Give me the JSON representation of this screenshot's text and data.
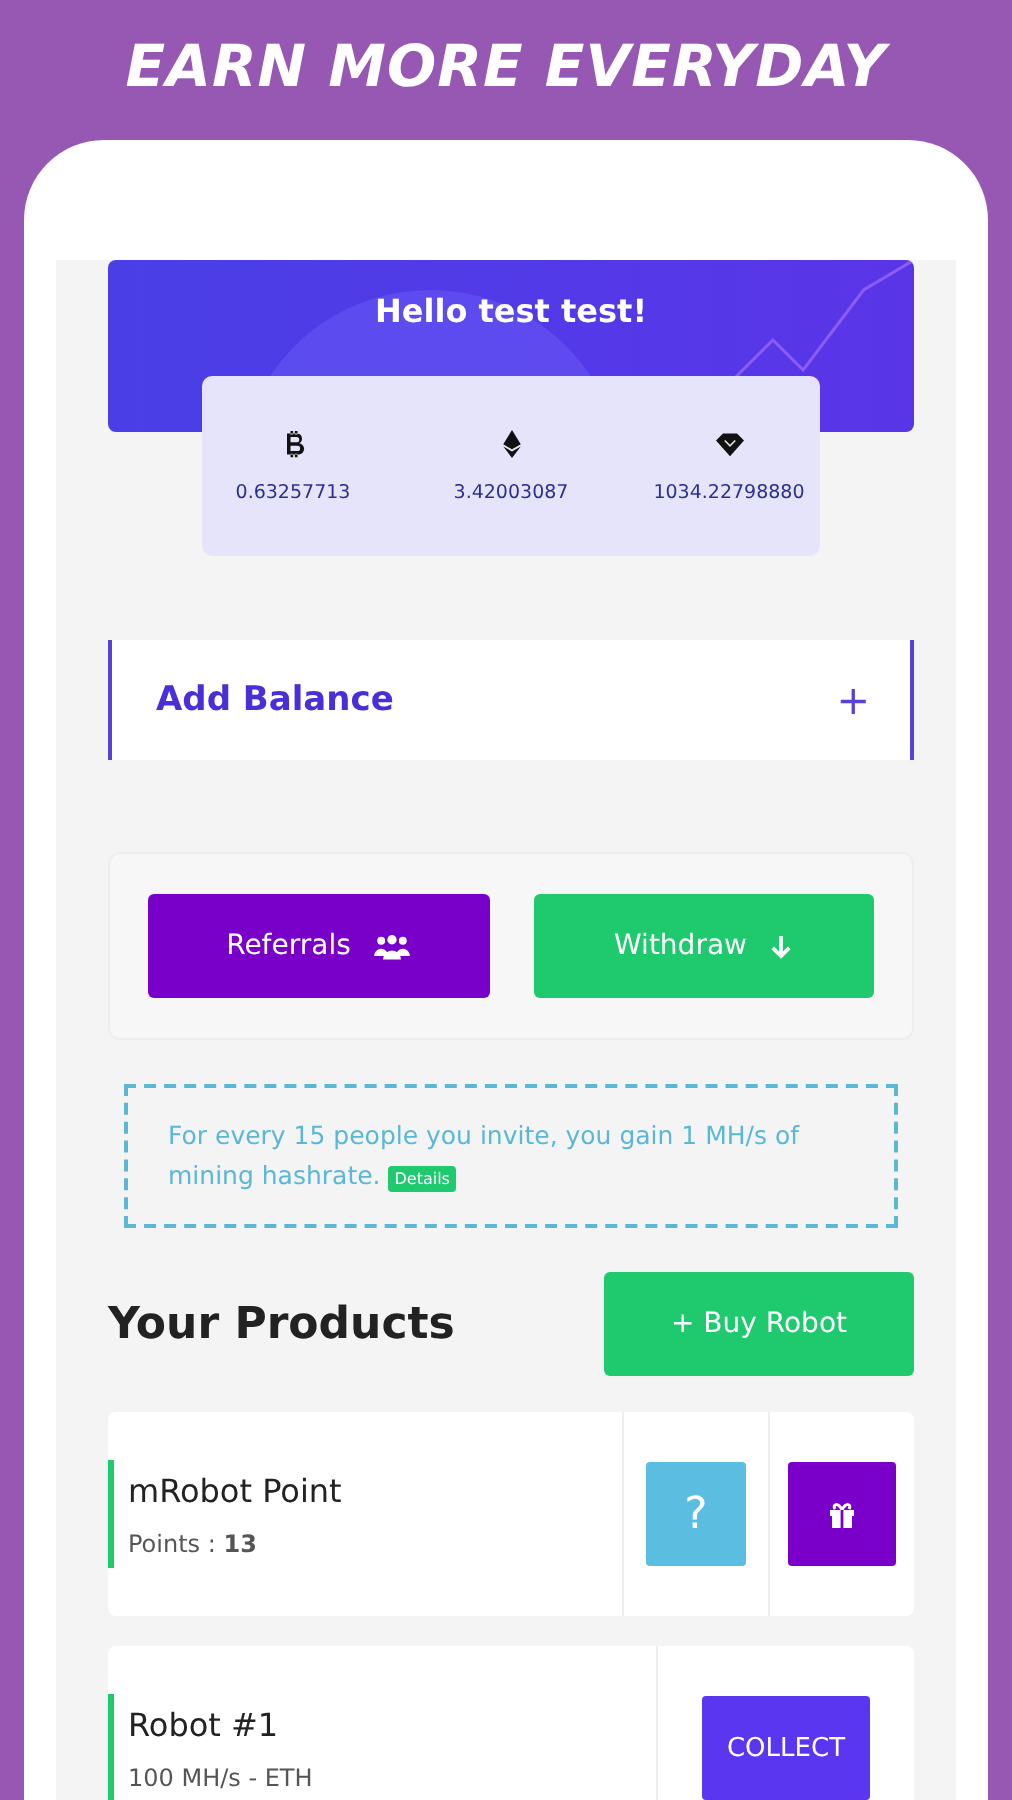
{
  "headline": "EARN MORE EVERYDAY",
  "greeting": "Hello test test!",
  "balances": [
    {
      "kind": "btc",
      "amount": "0.63257713"
    },
    {
      "kind": "eth",
      "amount": "3.42003087"
    },
    {
      "kind": "gem",
      "amount": "1034.22798880"
    }
  ],
  "add_balance": {
    "label": "Add Balance",
    "toggle": "+"
  },
  "actions": [
    {
      "kind": "referrals",
      "label": "Referrals"
    },
    {
      "kind": "withdraw",
      "label": "Withdraw"
    }
  ],
  "info": {
    "text": "For every 15 people you invite, you gain 1 MH/s of mining hashrate.",
    "link": "Details"
  },
  "products_title": "Your Products",
  "buy_button": "+ Buy Robot",
  "products": [
    {
      "name": "mRobot Point",
      "detail": "Points : **13**",
      "buttons": [
        {
          "kind": "help",
          "label": "?"
        },
        {
          "kind": "gift"
        }
      ]
    },
    {
      "name": "Robot #1",
      "detail": "100 MH/s - ETH",
      "buttons": [
        {
          "kind": "collect",
          "label": "COLLECT"
        }
      ]
    }
  ]
}
